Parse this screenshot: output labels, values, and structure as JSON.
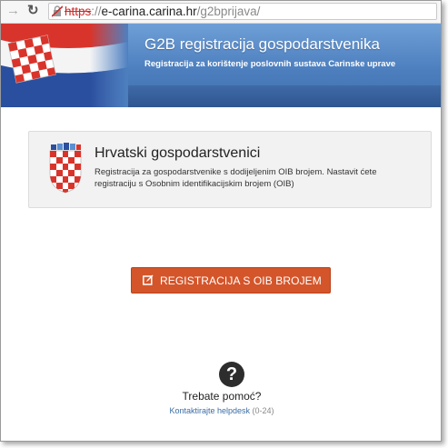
{
  "browser": {
    "url_scheme": "https",
    "url_separator": "://",
    "url_host": "e-carina.carina.hr",
    "url_path": "/g2bprijava/"
  },
  "header": {
    "title": "G2B registracija gospodarstvenika",
    "subtitle": "Registracija za korištenje poslovnih sustava Carinske uprave"
  },
  "panel": {
    "title": "Hrvatski gospodarstvenici",
    "description": "Registracija za gospodarstvenike s dodijeljenim OIB brojem. Nastavit ćete registraciju s Osobnim identifikacijskim brojem (OIB)"
  },
  "register_button": {
    "label": "REGISTRACIJA S OIB BROJEM",
    "icon": "edit-icon"
  },
  "help": {
    "icon": "question-icon",
    "glyph": "?",
    "title": "Trebate pomoć?",
    "link_text": "Kontaktirajte helpdesk",
    "hours": "(0-24)"
  },
  "colors": {
    "banner": "#4d7fbf",
    "button": "#d4552a",
    "link": "#3b6ea5"
  }
}
